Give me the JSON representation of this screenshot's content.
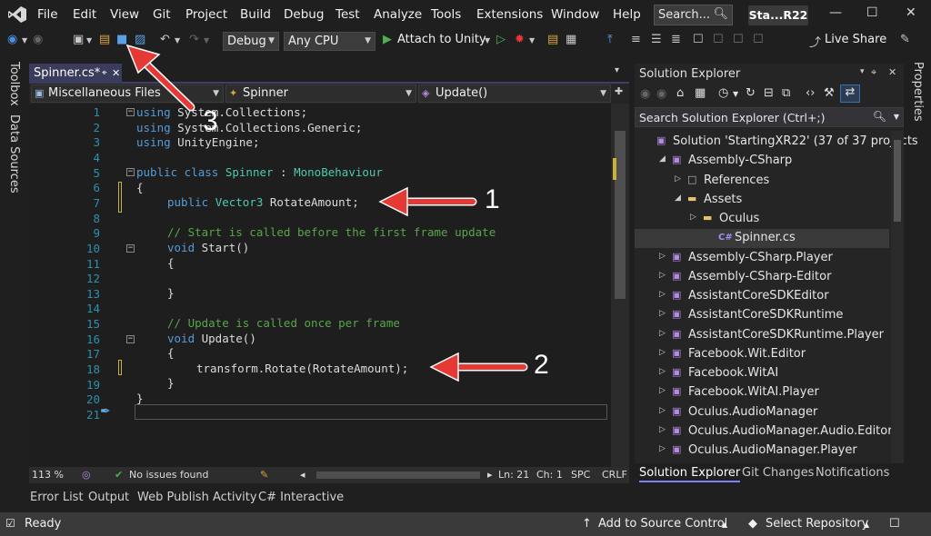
{
  "colors": {
    "accent_purple": "#3b3b5c",
    "annotation_arrow": "#e53935",
    "keyword": "#569cd6",
    "type": "#4ec9b0",
    "comment": "#57a64a",
    "line_number": "#2b91af",
    "csharp_icon": "#a58cf0"
  },
  "menu": {
    "items": [
      "File",
      "Edit",
      "View",
      "Git",
      "Project",
      "Build",
      "Debug",
      "Test",
      "Analyze",
      "Tools",
      "Extensions",
      "Window",
      "Help"
    ],
    "search_label": "Search...",
    "solution_short": "Sta...R22"
  },
  "toolbar": {
    "configuration": "Debug",
    "platform": "Any CPU",
    "attach_label": "Attach to Unity",
    "live_share_label": "Live Share"
  },
  "left_rail": {
    "toolbox": "Toolbox",
    "data_sources": "Data Sources"
  },
  "right_rail": {
    "properties": "Properties"
  },
  "editor": {
    "tab_label": "Spinner.cs*",
    "nav_project": "Miscellaneous Files",
    "nav_class": "Spinner",
    "nav_member": "Update()",
    "line_numbers": [
      "1",
      "2",
      "3",
      "4",
      "5",
      "6",
      "7",
      "8",
      "9",
      "10",
      "11",
      "12",
      "13",
      "14",
      "15",
      "16",
      "17",
      "18",
      "19",
      "20",
      "21"
    ],
    "lines": {
      "l1_kw": "using",
      "l1_rest": " System.Collections;",
      "l2_kw": "using",
      "l2_rest": " System.Collections.Generic;",
      "l3_kw": "using",
      "l3_rest": " UnityEngine;",
      "l5_kw": "public class",
      "l5_type": "Spinner",
      "l5_sep": " : ",
      "l5_base": "MonoBehaviour",
      "l6": "{",
      "l7_kw": "public",
      "l7_type": "Vector3",
      "l7_rest": " RotateAmount;",
      "l9": "// Start is called before the first frame update",
      "l10_kw": "void",
      "l10_rest": " Start()",
      "l11": "{",
      "l13": "}",
      "l15": "// Update is called once per frame",
      "l16_kw": "void",
      "l16_rest": " Update()",
      "l17": "{",
      "l18": "transform.Rotate(RotateAmount);",
      "l19": "}",
      "l20": "}"
    },
    "status": {
      "zoom": "113 %",
      "issues": "No issues found",
      "line": "Ln: 21",
      "col": "Ch: 1",
      "whitespace": "SPC",
      "line_ending": "CRLF"
    }
  },
  "bottom_tabs": [
    "Error List",
    "Output",
    "Web Publish Activity",
    "C# Interactive"
  ],
  "solution_explorer": {
    "title": "Solution Explorer",
    "search_placeholder": "Search Solution Explorer (Ctrl+;)",
    "tree": [
      {
        "label": "Solution 'StartingXR22' (37 of 37 projects",
        "level": 0,
        "icon": "solution-icon",
        "expander": ""
      },
      {
        "label": "Assembly-CSharp",
        "level": 1,
        "icon": "project-icon",
        "expander": "◢"
      },
      {
        "label": "References",
        "level": 2,
        "icon": "references-icon",
        "expander": "▷"
      },
      {
        "label": "Assets",
        "level": 2,
        "icon": "folder-icon",
        "expander": "◢"
      },
      {
        "label": "Oculus",
        "level": 3,
        "icon": "folder-icon",
        "expander": "▷"
      },
      {
        "label": "Spinner.cs",
        "level": 4,
        "icon": "csharp-file-icon",
        "expander": ""
      },
      {
        "label": "Assembly-CSharp.Player",
        "level": 1,
        "icon": "project-icon",
        "expander": "▷"
      },
      {
        "label": "Assembly-CSharp-Editor",
        "level": 1,
        "icon": "project-icon",
        "expander": "▷"
      },
      {
        "label": "AssistantCoreSDKEditor",
        "level": 1,
        "icon": "project-icon",
        "expander": "▷"
      },
      {
        "label": "AssistantCoreSDKRuntime",
        "level": 1,
        "icon": "project-icon",
        "expander": "▷"
      },
      {
        "label": "AssistantCoreSDKRuntime.Player",
        "level": 1,
        "icon": "project-icon",
        "expander": "▷"
      },
      {
        "label": "Facebook.Wit.Editor",
        "level": 1,
        "icon": "project-icon",
        "expander": "▷"
      },
      {
        "label": "Facebook.WitAI",
        "level": 1,
        "icon": "project-icon",
        "expander": "▷"
      },
      {
        "label": "Facebook.WitAI.Player",
        "level": 1,
        "icon": "project-icon",
        "expander": "▷"
      },
      {
        "label": "Oculus.AudioManager",
        "level": 1,
        "icon": "project-icon",
        "expander": "▷"
      },
      {
        "label": "Oculus.AudioManager.Audio.Editor",
        "level": 1,
        "icon": "project-icon",
        "expander": "▷"
      },
      {
        "label": "Oculus.AudioManager.Player",
        "level": 1,
        "icon": "project-icon",
        "expander": "▷"
      }
    ],
    "tabs": [
      "Solution Explorer",
      "Git Changes",
      "Notifications"
    ]
  },
  "statusbar": {
    "ready": "Ready",
    "add_source_control": "Add to Source Control",
    "select_repository": "Select Repository"
  },
  "annotations": {
    "one": "1",
    "two": "2",
    "three": "3"
  }
}
